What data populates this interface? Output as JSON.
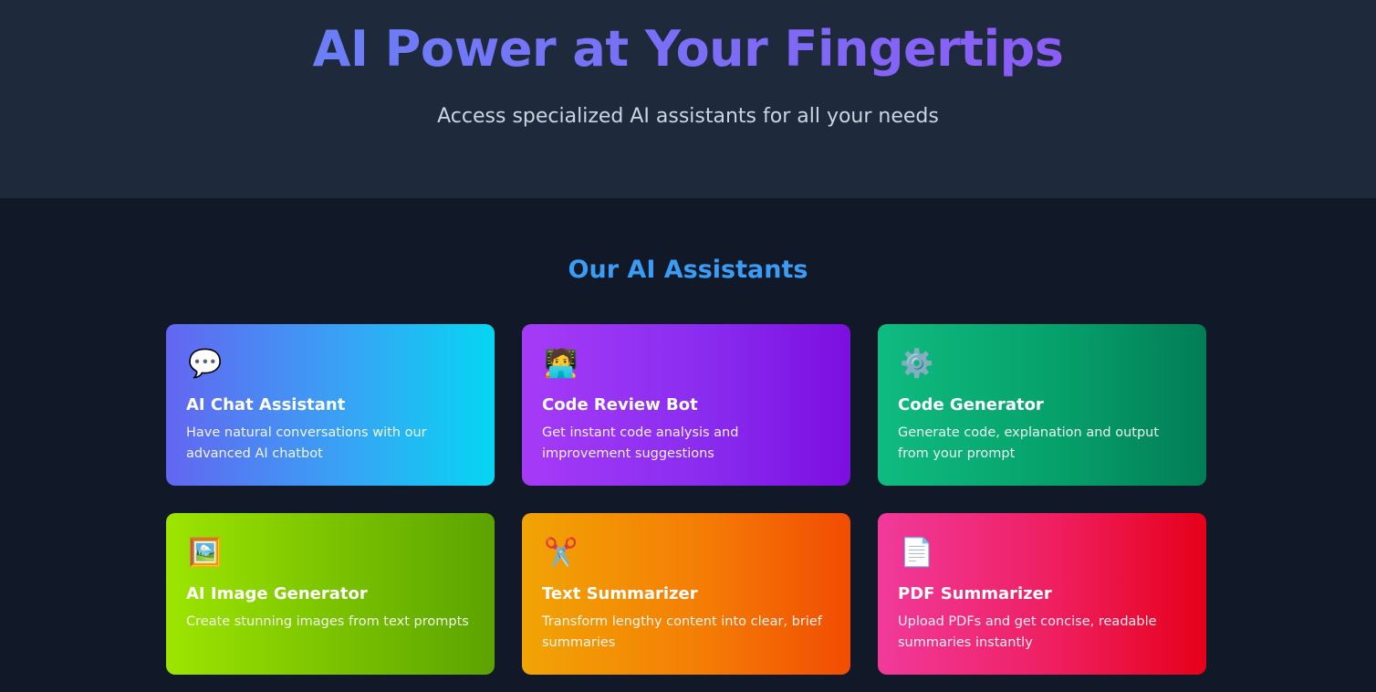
{
  "hero": {
    "title": "AI Power at Your Fingertips",
    "subtitle": "Access specialized AI assistants for all your needs"
  },
  "section": {
    "title": "Our AI Assistants"
  },
  "cards": [
    {
      "icon": "💬",
      "icon_name": "speech-bubble-icon",
      "title": "AI Chat Assistant",
      "description": "Have natural conversations with our advanced AI chatbot"
    },
    {
      "icon": "🧑‍💻",
      "icon_name": "technologist-icon",
      "title": "Code Review Bot",
      "description": "Get instant code analysis and improvement suggestions"
    },
    {
      "icon": "⚙️",
      "icon_name": "gear-icon",
      "title": "Code Generator",
      "description": "Generate code, explanation and output from your prompt"
    },
    {
      "icon": "🖼️",
      "icon_name": "framed-picture-icon",
      "title": "AI Image Generator",
      "description": "Create stunning images from text prompts"
    },
    {
      "icon": "✂️",
      "icon_name": "scissors-icon",
      "title": "Text Summarizer",
      "description": "Transform lengthy content into clear, brief summaries"
    },
    {
      "icon": "📄",
      "icon_name": "document-icon",
      "title": "PDF Summarizer",
      "description": "Upload PDFs and get concise, readable summaries instantly"
    }
  ],
  "colors": {
    "page_background": "#111827",
    "hero_background": "#1e293b",
    "title_gradient_start": "#6b7ff7",
    "title_gradient_end": "#8b5cf6",
    "section_title": "#3b9cf6"
  }
}
